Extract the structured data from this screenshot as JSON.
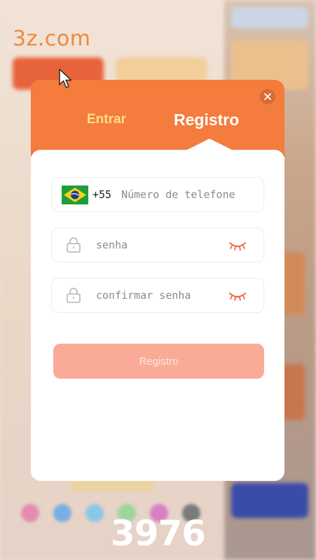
{
  "watermark": "3z.com",
  "counter": "3976",
  "modal": {
    "tabs": {
      "login": "Entrar",
      "register": "Registro"
    },
    "phone": {
      "country_code": "+55",
      "placeholder": "Número de telefone",
      "flag": "brazil-flag-icon"
    },
    "password": {
      "placeholder": "senha"
    },
    "confirm_password": {
      "placeholder": "confirmar senha"
    },
    "submit_label": "Registro"
  },
  "colors": {
    "accent": "#f47c3c",
    "tab_inactive": "#ffe08a",
    "submit_disabled": "#f9ab97",
    "eye_icon": "#f05a28"
  }
}
